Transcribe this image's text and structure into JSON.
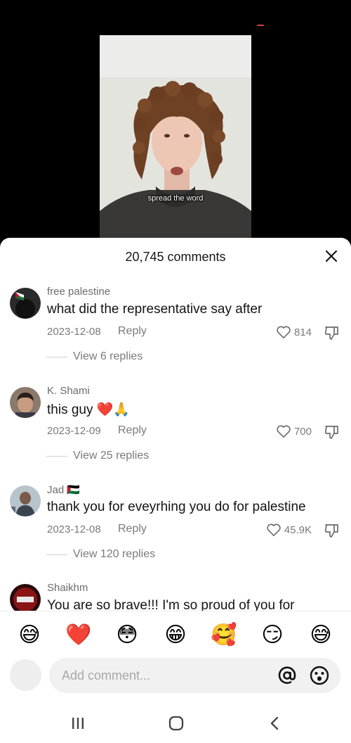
{
  "video": {
    "caption": "spread the word"
  },
  "sheet": {
    "count_label": "20,745 comments"
  },
  "comments": [
    {
      "author": "free palestine",
      "text": "what did the representative say after",
      "date": "2023-12-08",
      "reply_label": "Reply",
      "likes": "814",
      "replies_label": "View 6 replies"
    },
    {
      "author": "K. Shami",
      "text": "this guy ❤️🙏",
      "date": "2023-12-09",
      "reply_label": "Reply",
      "likes": "700",
      "replies_label": "View 25 replies"
    },
    {
      "author": "Jad 🇵🇸",
      "text": "thank you for eveyrhing you do for palestine",
      "date": "2023-12-08",
      "reply_label": "Reply",
      "likes": "45.9K",
      "replies_label": "View 120 replies"
    },
    {
      "author": "Shaikhm",
      "text": "You are so brave!!! I'm so proud of you for"
    }
  ],
  "emoji_bar": [
    "😅",
    "❤️",
    "😳",
    "😁",
    "🥰",
    "😏",
    "😅"
  ],
  "input": {
    "placeholder": "Add comment..."
  }
}
